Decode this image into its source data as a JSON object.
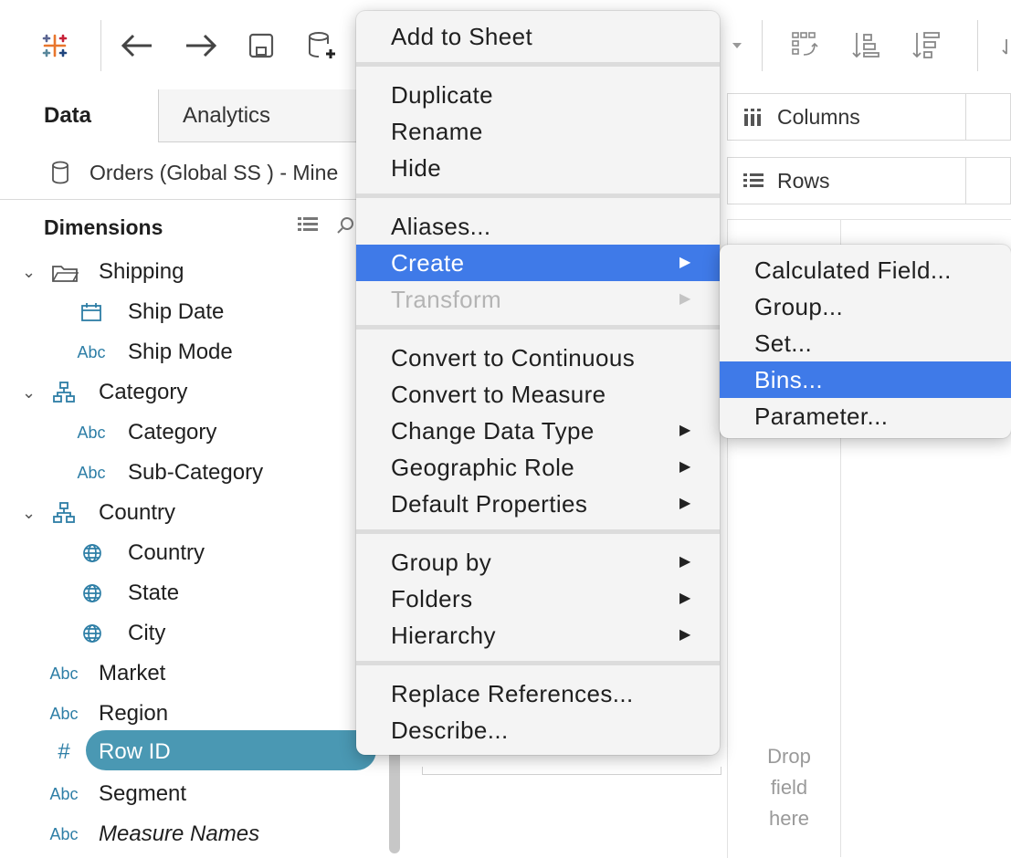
{
  "tabs": {
    "data": "Data",
    "analytics": "Analytics"
  },
  "datasource": {
    "name": "Orders (Global SS ) - Mine"
  },
  "dimensions": {
    "title": "Dimensions",
    "items": [
      {
        "label": "Shipping",
        "type": "folder"
      },
      {
        "label": "Ship Date",
        "type": "date"
      },
      {
        "label": "Ship Mode",
        "type": "Abc"
      },
      {
        "label": "Category",
        "type": "hierarchy"
      },
      {
        "label": "Category",
        "type": "Abc"
      },
      {
        "label": "Sub-Category",
        "type": "Abc"
      },
      {
        "label": "Country",
        "type": "hierarchy"
      },
      {
        "label": "Country",
        "type": "geo"
      },
      {
        "label": "State",
        "type": "geo"
      },
      {
        "label": "City",
        "type": "geo"
      },
      {
        "label": "Market",
        "type": "Abc"
      },
      {
        "label": "Region",
        "type": "Abc"
      },
      {
        "label": "Row ID",
        "type": "#"
      },
      {
        "label": "Segment",
        "type": "Abc"
      },
      {
        "label": "Measure Names",
        "type": "Abc"
      }
    ]
  },
  "type_labels": {
    "abc": "Abc",
    "number": "#"
  },
  "shelves": {
    "columns": "Columns",
    "rows": "Rows"
  },
  "viz": {
    "drop_line1": "Drop",
    "drop_line2": "field",
    "drop_line3": "here"
  },
  "context_menu": {
    "add_to_sheet": "Add to Sheet",
    "duplicate": "Duplicate",
    "rename": "Rename",
    "hide": "Hide",
    "aliases": "Aliases...",
    "create": "Create",
    "transform": "Transform",
    "convert_continuous": "Convert to Continuous",
    "convert_measure": "Convert to Measure",
    "change_data_type": "Change Data Type",
    "geographic_role": "Geographic Role",
    "default_properties": "Default Properties",
    "group_by": "Group by",
    "folders": "Folders",
    "hierarchy": "Hierarchy",
    "replace_references": "Replace References...",
    "describe": "Describe..."
  },
  "create_submenu": {
    "calculated_field": "Calculated Field...",
    "group": "Group...",
    "set": "Set...",
    "bins": "Bins...",
    "parameter": "Parameter..."
  },
  "colors": {
    "highlight": "#3f7ae8",
    "pill": "#4a98b3",
    "type_icon": "#2d7ea6"
  }
}
